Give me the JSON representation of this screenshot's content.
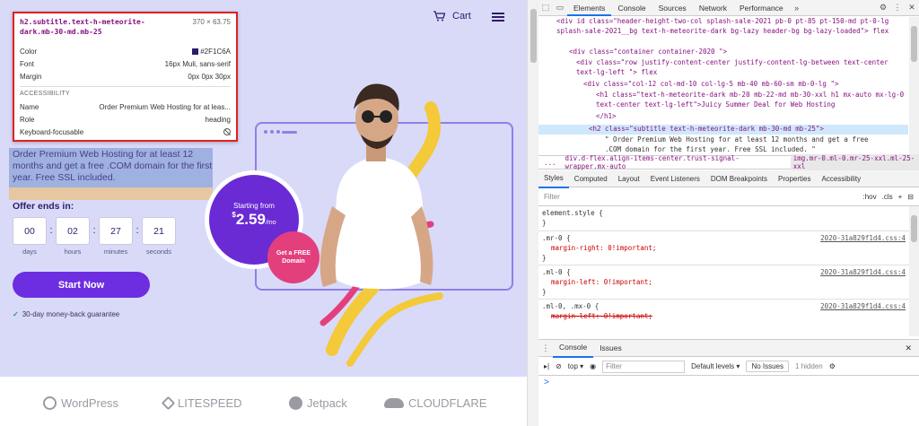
{
  "site": {
    "cart_label": "Cart",
    "subtitle": "Order Premium Web Hosting for at least 12 months and get a free .COM domain for the first year. Free SSL included.",
    "offer_label": "Offer ends in:",
    "timer": [
      {
        "value": "00",
        "unit": "days"
      },
      {
        "value": "02",
        "unit": "hours"
      },
      {
        "value": "27",
        "unit": "minutes"
      },
      {
        "value": "21",
        "unit": "seconds"
      }
    ],
    "start_button": "Start Now",
    "guarantee": "30-day money-back guarantee",
    "price_label": "Starting from",
    "price_currency": "$",
    "price_value": "2.59",
    "price_period": "/mo",
    "free_domain": "Get a FREE Domain",
    "partners": [
      "WordPress",
      "LITESPEED",
      "Jetpack",
      "CLOUDFLARE"
    ]
  },
  "tooltip": {
    "selector": "h2.subtitle.text-h-meteorite-dark.mb-30-md.mb-25",
    "size": "370 × 63.75",
    "color_label": "Color",
    "color_value": "#2F1C6A",
    "font_label": "Font",
    "font_value": "16px Muli, sans-serif",
    "margin_label": "Margin",
    "margin_value": "0px 0px 30px",
    "accessibility_header": "ACCESSIBILITY",
    "name_label": "Name",
    "name_value": "Order Premium Web Hosting for at leas...",
    "role_label": "Role",
    "role_value": "heading",
    "keyboard_label": "Keyboard-focusable"
  },
  "devtools": {
    "tabs": [
      "Elements",
      "Console",
      "Sources",
      "Network",
      "Performance"
    ],
    "elements_lines": [
      "<div id class=\"header-height-two-col splash-sale-2021 pb-0 pt-85 pt-150-md pt-0-lg splash-sale-2021__bg text-h-meteorite-dark bg-lazy header-bg bg-lazy-loaded\"> flex",
      "<div class=\"container container-2020 \">",
      "<div class=\"row justify-content-center justify-content-lg-between text-center text-lg-left   \"> flex",
      "<div class=\"col-12 col-md-10 col-lg-5  mb-40 mb-60-sm mb-0-lg \">",
      "<h1 class=\"text-h-meteorite-dark mb-20 mb-22-md mb-30-xxl h1 mx-auto mx-lg-0 text-center text-lg-left\">Juicy Summer Deal for Web Hosting",
      "</h1>",
      "<h2 class=\"subtitle text-h-meteorite-dark mb-30-md mb-25\">",
      "\" Order Premium Web Hosting for at least 12 months and get a free",
      ".COM domain for the first year. Free SSL included. \""
    ],
    "breadcrumb": [
      "...",
      "div.d-flex.align-items-center.trust-signal-wrapper.mx-auto",
      "img.mr-0.ml-0.mr-25-xxl.ml-25-xxl"
    ],
    "style_tabs": [
      "Styles",
      "Computed",
      "Layout",
      "Event Listeners",
      "DOM Breakpoints",
      "Properties",
      "Accessibility"
    ],
    "filter_placeholder": "Filter",
    "filter_hov": ":hov",
    "filter_cls": ".cls",
    "rules": [
      {
        "selector": "element.style {",
        "source": "",
        "props": [],
        "close": "}"
      },
      {
        "selector": ".mr-0 {",
        "source": "2020-31a829f1d4.css:4",
        "props": [
          "margin-right: 0!important;"
        ],
        "close": "}"
      },
      {
        "selector": ".ml-0 {",
        "source": "2020-31a829f1d4.css:4",
        "props": [
          "margin-left: 0!important;"
        ],
        "close": "}"
      },
      {
        "selector": ".ml-0, .mx-0 {",
        "source": "2020-31a829f1d4.css:4",
        "props": [
          "margin-left: 0!important;"
        ],
        "close": ""
      }
    ],
    "console_tabs": [
      "Console",
      "Issues"
    ],
    "console_context": "top",
    "console_filter": "Filter",
    "console_levels": "Default levels",
    "console_issues": "No Issues",
    "console_hidden": "1 hidden",
    "prompt": ">"
  }
}
